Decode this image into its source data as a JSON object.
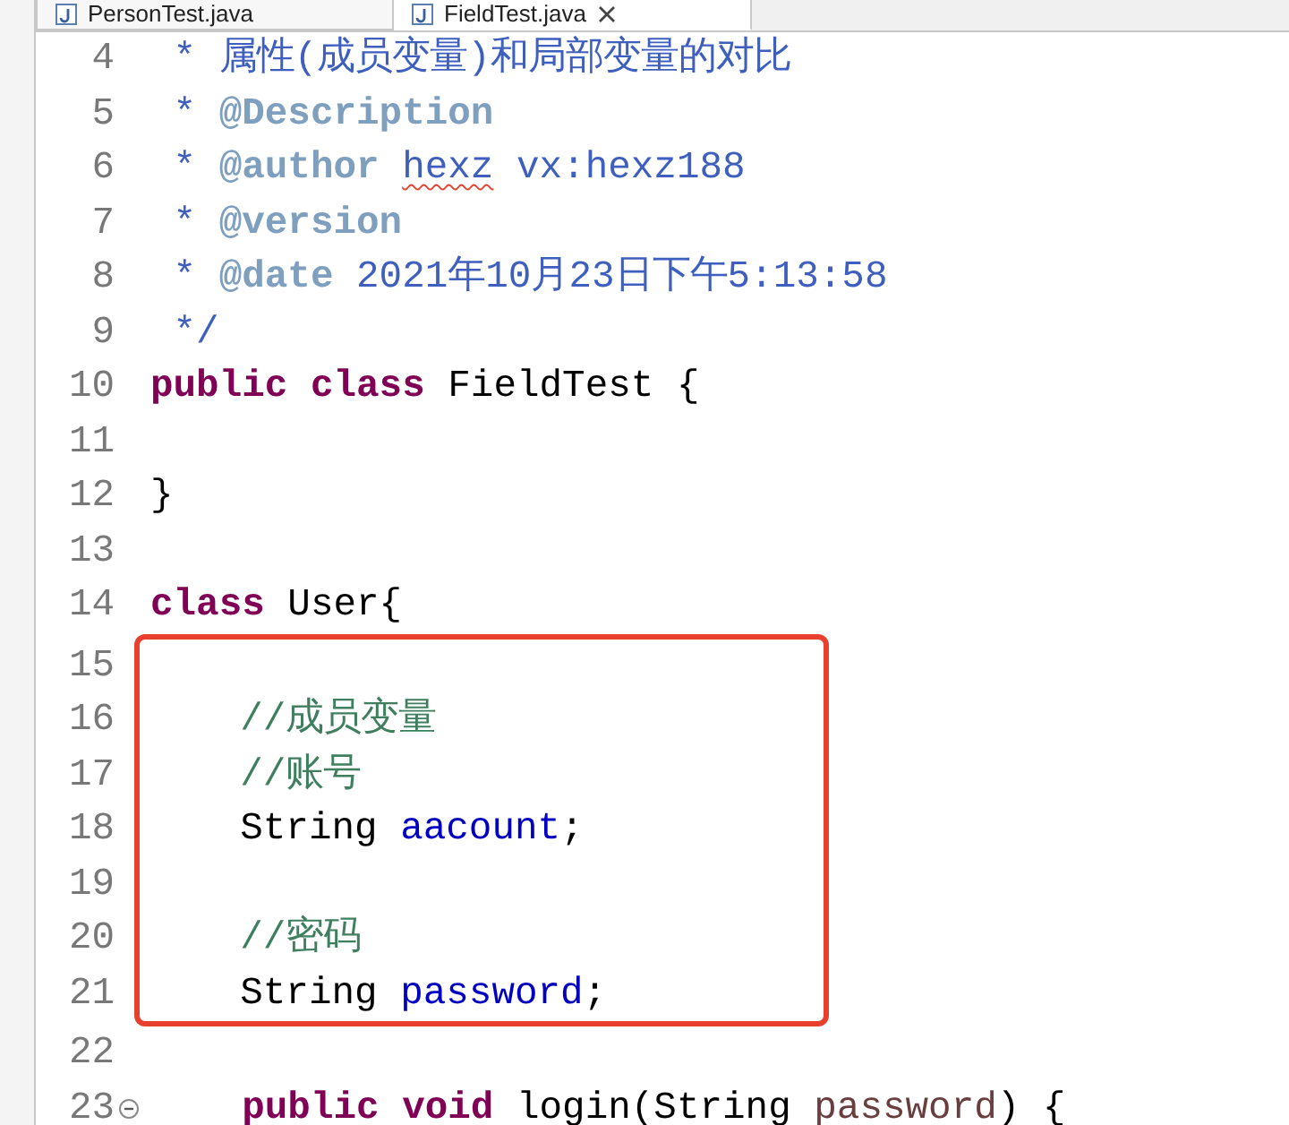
{
  "tabs": [
    {
      "label": "PersonTest.java",
      "selected": false,
      "closable": false
    },
    {
      "label": "FieldTest.java",
      "selected": true,
      "closable": true
    }
  ],
  "code": [
    {
      "boxed": false,
      "lines": [
        {
          "number": "4",
          "tokens": [
            {
              "kind": "doc",
              "text": " * 属性(成员变量)和局部变量的对比"
            }
          ]
        },
        {
          "number": "5",
          "tokens": [
            {
              "kind": "doc",
              "text": " * "
            },
            {
              "kind": "tag",
              "text": "@Description"
            }
          ]
        },
        {
          "number": "6",
          "tokens": [
            {
              "kind": "doc",
              "text": " * "
            },
            {
              "kind": "tag",
              "text": "@author "
            },
            {
              "kind": "doc",
              "text": "hexz",
              "misspelled": true
            },
            {
              "kind": "doc",
              "text": " vx:hexz188"
            }
          ]
        },
        {
          "number": "7",
          "tokens": [
            {
              "kind": "doc",
              "text": " * "
            },
            {
              "kind": "tag",
              "text": "@version"
            }
          ]
        },
        {
          "number": "8",
          "tokens": [
            {
              "kind": "doc",
              "text": " * "
            },
            {
              "kind": "tag",
              "text": "@date"
            },
            {
              "kind": "doc",
              "text": " 2021年10月23日下午5:13:58"
            }
          ]
        },
        {
          "number": "9",
          "tokens": [
            {
              "kind": "doc",
              "text": " */"
            }
          ]
        },
        {
          "number": "10",
          "tokens": [
            {
              "kind": "keyword",
              "text": "public class"
            },
            {
              "kind": "plain",
              "text": " FieldTest {"
            }
          ]
        },
        {
          "number": "11"
        },
        {
          "number": "12",
          "tokens": [
            {
              "kind": "plain",
              "text": "}"
            }
          ]
        },
        {
          "number": "13"
        },
        {
          "number": "14",
          "tokens": [
            {
              "kind": "keyword",
              "text": "class"
            },
            {
              "kind": "plain",
              "text": " User{"
            }
          ]
        }
      ]
    },
    {
      "boxed": true,
      "lines": [
        {
          "number": "15"
        },
        {
          "number": "16",
          "tokens": [
            {
              "kind": "comment",
              "text": "    //成员变量"
            }
          ]
        },
        {
          "number": "17",
          "tokens": [
            {
              "kind": "comment",
              "text": "    //账号"
            }
          ]
        },
        {
          "number": "18",
          "tokens": [
            {
              "kind": "plain",
              "text": "    String "
            },
            {
              "kind": "field",
              "text": "aacount"
            },
            {
              "kind": "plain",
              "text": ";"
            }
          ]
        },
        {
          "number": "19"
        },
        {
          "number": "20",
          "tokens": [
            {
              "kind": "comment",
              "text": "    //密码"
            }
          ]
        },
        {
          "number": "21",
          "tokens": [
            {
              "kind": "plain",
              "text": "    String "
            },
            {
              "kind": "field",
              "text": "password"
            },
            {
              "kind": "plain",
              "text": ";"
            }
          ]
        }
      ]
    },
    {
      "boxed": false,
      "lines": [
        {
          "number": "22"
        },
        {
          "number": "23",
          "fold": true,
          "tokens": [
            {
              "kind": "keyword",
              "text": "    public void"
            },
            {
              "kind": "plain",
              "text": " login(String "
            },
            {
              "kind": "param",
              "text": "password"
            },
            {
              "kind": "plain",
              "text": ") {"
            }
          ]
        }
      ]
    }
  ]
}
